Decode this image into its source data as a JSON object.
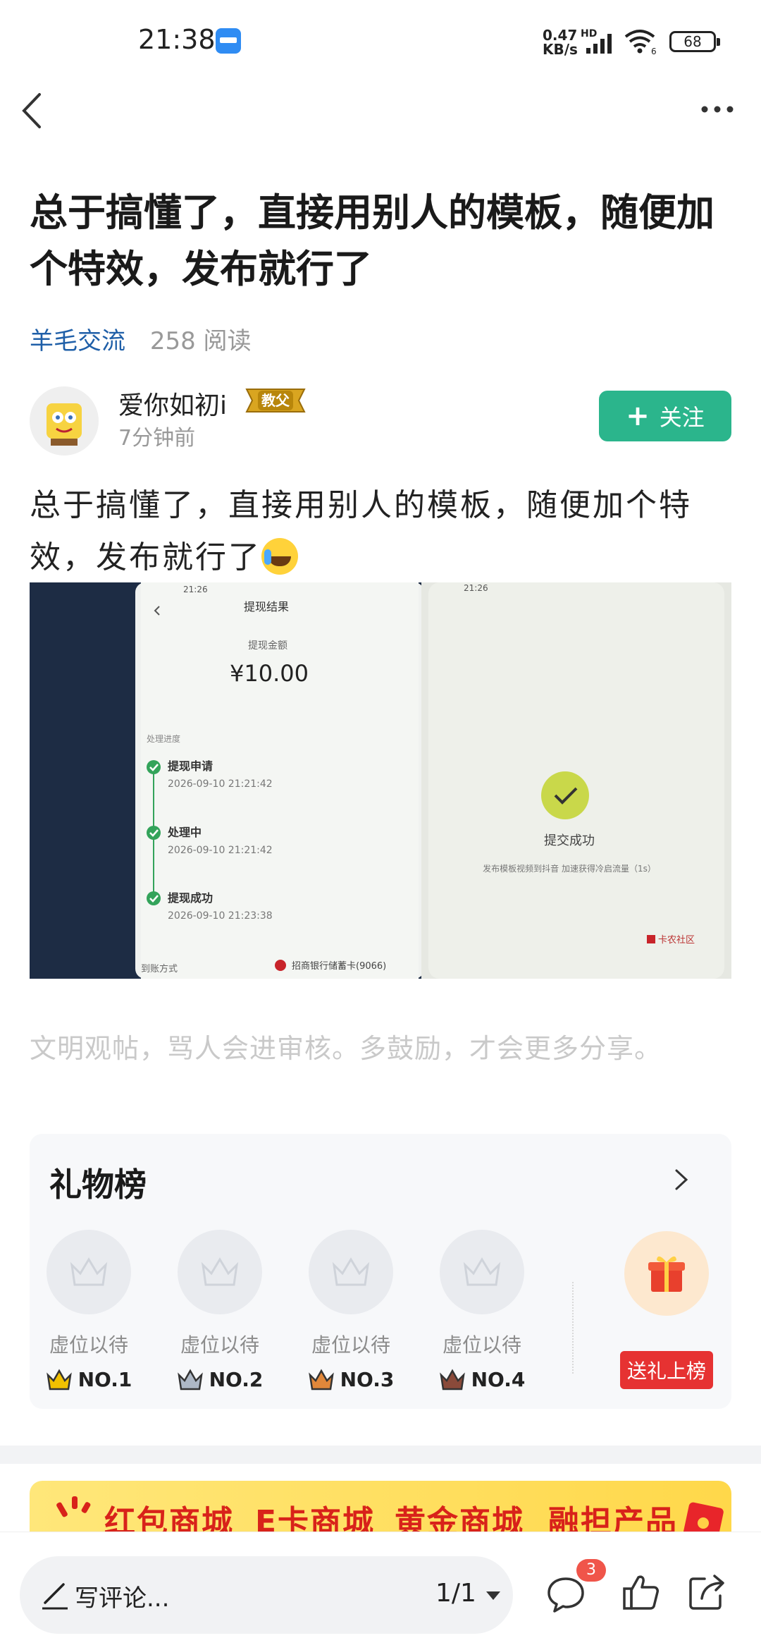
{
  "status_bar": {
    "time": "21:38",
    "net_speed_value": "0.47",
    "net_speed_unit": "KB/s",
    "network_type": "HD",
    "wifi_index": "6",
    "battery": "68",
    "icons": [
      "wallet-app-icon",
      "signal-icon",
      "wifi-icon",
      "battery-icon"
    ]
  },
  "nav": {
    "back_icon": "chevron-left-icon",
    "more_icon": "more-dots-icon"
  },
  "post": {
    "title": "总于搞懂了，直接用别人的模板，随便加个特效，发布就行了",
    "circle": "羊毛交流",
    "read_count": "258 阅读",
    "author": {
      "name": "爱你如初i",
      "badge": "教父",
      "time": "7分钟前",
      "follow_label": "关注"
    },
    "body": "总于搞懂了，直接用别人的模板，随便加个特效，发布就行了",
    "image": {
      "left_phone": {
        "time": "21:26",
        "header": "提现结果",
        "amount_label": "提现金额",
        "amount": "¥10.00",
        "progress_label": "处理进度",
        "steps": [
          {
            "name": "提现申请",
            "time": "2026-09-10 21:21:42"
          },
          {
            "name": "处理中",
            "time": "2026-09-10 21:21:42"
          },
          {
            "name": "提现成功",
            "time": "2026-09-10 21:23:38"
          }
        ],
        "account_label": "到账方式",
        "account_value": "招商银行储蓄卡(9066)"
      },
      "right_phone": {
        "time": "21:26",
        "success_text": "提交成功",
        "hint": "发布模板视频到抖音 加速获得冷启流量（1s）",
        "watermark": "卡农社区"
      }
    }
  },
  "notice": "文明观帖，骂人会进审核。多鼓励，才会更多分享。",
  "gift": {
    "title": "礼物榜",
    "slots": [
      {
        "label": "虚位以待",
        "rank": "NO.1",
        "color": "#f2c100"
      },
      {
        "label": "虚位以待",
        "rank": "NO.2",
        "color": "#aeb8c6"
      },
      {
        "label": "虚位以待",
        "rank": "NO.3",
        "color": "#e0873a"
      },
      {
        "label": "虚位以待",
        "rank": "NO.4",
        "color": "#8a4a3a"
      }
    ],
    "send_label": "送礼上榜"
  },
  "shop": {
    "items": [
      "红包商城",
      "E卡商城",
      "黄金商城",
      "融担产品"
    ]
  },
  "bottom": {
    "comment_placeholder": "写评论...",
    "page": "1/1",
    "comment_count": "3"
  },
  "colors": {
    "accent_green": "#2bb58c",
    "link_blue": "#1f5fa8",
    "gift_red": "#e63232"
  }
}
